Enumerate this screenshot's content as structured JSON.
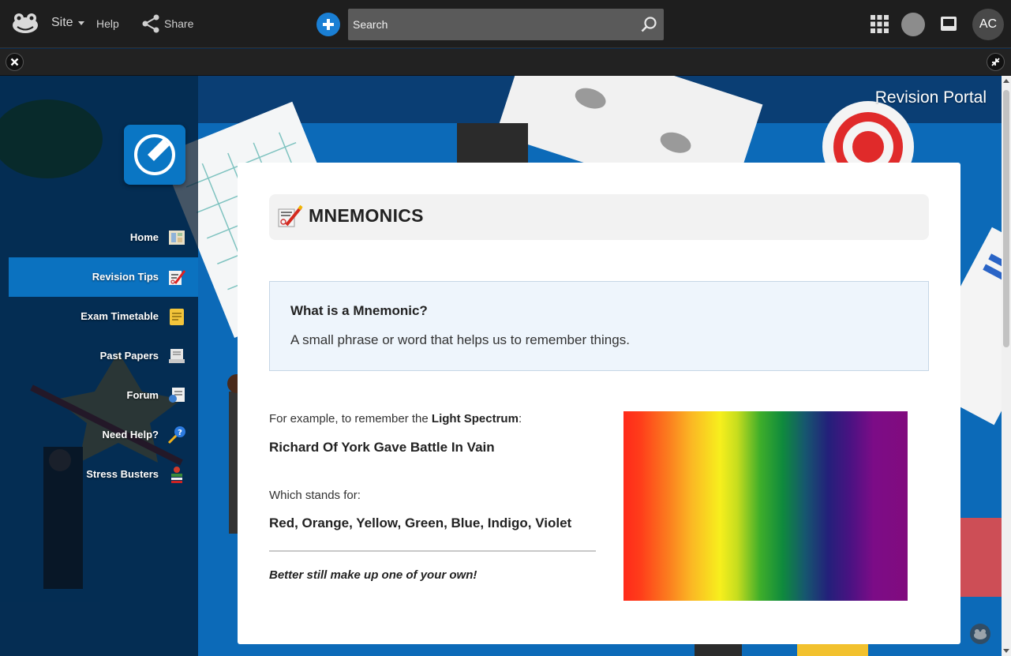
{
  "topbar": {
    "site_label": "Site",
    "help_label": "Help",
    "share_label": "Share",
    "search_placeholder": "Search",
    "avatar_initials": "AC"
  },
  "portal": {
    "title": "Revision Portal"
  },
  "sidebar": {
    "items": [
      {
        "label": "Home",
        "icon": "home-icon",
        "active": false
      },
      {
        "label": "Revision Tips",
        "icon": "revision-tips-icon",
        "active": true
      },
      {
        "label": "Exam Timetable",
        "icon": "timetable-icon",
        "active": false
      },
      {
        "label": "Past Papers",
        "icon": "past-papers-icon",
        "active": false
      },
      {
        "label": "Forum",
        "icon": "forum-icon",
        "active": false
      },
      {
        "label": "Need Help?",
        "icon": "help-icon",
        "active": false
      },
      {
        "label": "Stress Busters",
        "icon": "stress-busters-icon",
        "active": false
      }
    ]
  },
  "content": {
    "heading": "MNEMONICS",
    "info": {
      "title": "What is a Mnemonic?",
      "body": "A small phrase or word that helps us to remember things."
    },
    "example_intro_prefix": "For example, to remember the ",
    "example_intro_bold": "Light Spectrum",
    "example_intro_suffix": ":",
    "mnemonic": "Richard Of York Gave Battle In Vain",
    "stands_for": "Which stands for:",
    "colours": "Red, Orange, Yellow, Green, Blue, Indigo, Violet",
    "tip": "Better still make up one of your own!"
  },
  "colors": {
    "accent": "#0b72c0",
    "topbar": "#1e1e1e",
    "add_button": "#1a7fd4"
  }
}
